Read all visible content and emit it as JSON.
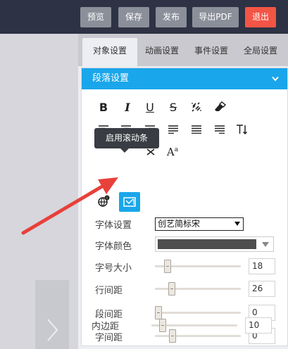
{
  "topbar": {
    "preview_label": "预览",
    "save_label": "保存",
    "publish_label": "发布",
    "export_pdf_label": "导出PDF",
    "exit_label": "退出",
    "exit_color": "#f25545"
  },
  "tabs": [
    {
      "label": "对象设置",
      "active": true
    },
    {
      "label": "动画设置",
      "active": false
    },
    {
      "label": "事件设置",
      "active": false
    },
    {
      "label": "全局设置",
      "active": false
    }
  ],
  "section": {
    "title": "段落设置",
    "accent": "#1aa6ea"
  },
  "toolbar_icons": [
    "bold-icon",
    "italic-icon",
    "underline-icon",
    "strikethrough-icon",
    "unlink-icon",
    "eraser-icon",
    "align-left-icon",
    "align-center-icon",
    "align-right-icon",
    "justify-left-icon",
    "justify-icon",
    "justify-right-icon",
    "line-height-icon",
    "font-size-icon",
    "world-icon",
    "scroll-text-icon"
  ],
  "tooltip": {
    "text": "启用滚动条"
  },
  "form": {
    "font_family": {
      "label": "字体设置",
      "value": "创艺简标宋"
    },
    "font_color": {
      "label": "字体颜色",
      "value": "#4e4e4e"
    },
    "font_size": {
      "label": "字号大小",
      "value": "18",
      "slider": 0.12
    },
    "line_height": {
      "label": "行间距",
      "value": "26",
      "slider": 0.17
    },
    "paragraph_spacing": {
      "label": "段间距",
      "value": "0",
      "slider": 0.0
    },
    "letter_spacing": {
      "label": "字间距",
      "value": "0",
      "slider": 0.18
    },
    "padding": {
      "label": "内边距",
      "value": "10",
      "slider": 0.1
    }
  }
}
